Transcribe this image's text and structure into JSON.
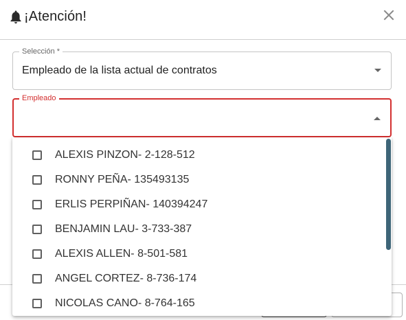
{
  "dialog": {
    "title": "¡Atención!",
    "title_icon": "bell-icon",
    "close_icon": "close-icon"
  },
  "fields": {
    "seleccion": {
      "label": "Selección *",
      "value": "Empleado de la lista actual de contratos"
    },
    "empleado": {
      "label": "Empleado",
      "value": ""
    }
  },
  "dropdown": {
    "options": [
      {
        "label": "ALEXIS PINZON- 2-128-512",
        "checked": false
      },
      {
        "label": "RONNY PEÑA- 135493135",
        "checked": false
      },
      {
        "label": "ERLIS PERPIÑAN- 140394247",
        "checked": false
      },
      {
        "label": "BENJAMIN LAU- 3-733-387",
        "checked": false
      },
      {
        "label": "ALEXIS ALLEN- 8-501-581",
        "checked": false
      },
      {
        "label": "ANGEL CORTEZ- 8-736-174",
        "checked": false
      },
      {
        "label": "NICOLAS CANO- 8-764-165",
        "checked": false
      }
    ]
  },
  "colors": {
    "error": "#d32f2f",
    "scrollbar": "#3e6578",
    "border": "#c4c4c4"
  }
}
